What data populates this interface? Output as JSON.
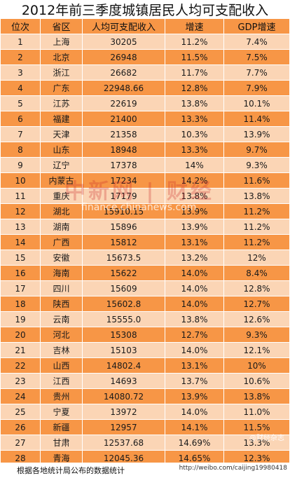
{
  "chart_data": {
    "type": "table",
    "title": "2012年前三季度城镇居民人均可支配收入",
    "columns": [
      "位次",
      "省区",
      "人均可支配收入",
      "增速",
      "GDP增速"
    ],
    "rows": [
      [
        "1",
        "上海",
        "30205",
        "11.2%",
        "7.4%"
      ],
      [
        "2",
        "北京",
        "26948",
        "11.5%",
        "7.5%"
      ],
      [
        "3",
        "浙江",
        "26682",
        "11.7%",
        "7.7%"
      ],
      [
        "4",
        "广东",
        "22948.66",
        "12.8%",
        "7.9%"
      ],
      [
        "5",
        "江苏",
        "22619",
        "13.8%",
        "10.1%"
      ],
      [
        "6",
        "福建",
        "21400",
        "13.3%",
        "11.4%"
      ],
      [
        "7",
        "天津",
        "21358",
        "10.3%",
        "13.9%"
      ],
      [
        "8",
        "山东",
        "18948",
        "13.3%",
        "9.7%"
      ],
      [
        "9",
        "辽宁",
        "17378",
        "14%",
        "9.3%"
      ],
      [
        "10",
        "内蒙古",
        "17234",
        "14.2%",
        "11.6%"
      ],
      [
        "11",
        "重庆",
        "17179",
        "13.8%",
        "13.8%"
      ],
      [
        "12",
        "湖北",
        "15910.15",
        "13.9%",
        "11.2%"
      ],
      [
        "13",
        "湖南",
        "15896",
        "13.9%",
        "11.2%"
      ],
      [
        "14",
        "广西",
        "15812",
        "13.1%",
        "11.2%"
      ],
      [
        "15",
        "安徽",
        "15673.5",
        "13.2%",
        "12%"
      ],
      [
        "16",
        "海南",
        "15622",
        "14.0%",
        "8.4%"
      ],
      [
        "17",
        "四川",
        "15609",
        "14.0%",
        "12.8%"
      ],
      [
        "18",
        "陕西",
        "15602.8",
        "14.0%",
        "12.7%"
      ],
      [
        "19",
        "云南",
        "15555.0",
        "13.8%",
        "12.6%"
      ],
      [
        "20",
        "河北",
        "15308",
        "12.7%",
        "9.3%"
      ],
      [
        "21",
        "吉林",
        "15103",
        "14.0%",
        "12.1%"
      ],
      [
        "22",
        "山西",
        "14802.4",
        "13.1%",
        "10%"
      ],
      [
        "23",
        "江西",
        "14693",
        "13.7%",
        "10.6%"
      ],
      [
        "24",
        "贵州",
        "14080.72",
        "13.9%",
        "13.8%"
      ],
      [
        "25",
        "宁夏",
        "13972",
        "14.0%",
        "11.0%"
      ],
      [
        "26",
        "新疆",
        "12957",
        "14.1%",
        "11.5%"
      ],
      [
        "27",
        "甘肃",
        "12537.68",
        "14.69%",
        "13.3%"
      ],
      [
        "28",
        "青海",
        "12045.36",
        "14.65%",
        "12.3%"
      ]
    ]
  },
  "footer": {
    "note": "根据各地统计局公布的数据统计",
    "source": "http://weibo.com/caijing19980418"
  },
  "watermark": {
    "brand": "中新网 | 财经",
    "url": "finance.chinanews.com"
  },
  "stamp": "@财经杂志",
  "colors": {
    "header_bg": "#f79646",
    "row_light": "#fbd5b5",
    "row_dark": "#f79646"
  }
}
